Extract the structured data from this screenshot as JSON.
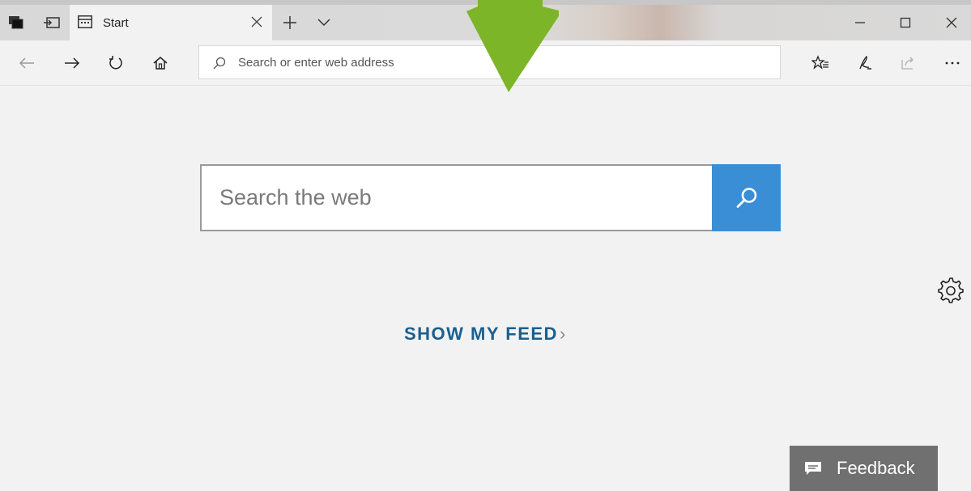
{
  "tabs": [
    {
      "title": "Start",
      "active": true
    }
  ],
  "titlebar": {
    "icons": [
      "set-aside-tabs-icon",
      "tab-preview-icon"
    ],
    "tab_menu_icon": "chevron-down-icon",
    "new_tab_icon": "plus-icon",
    "window_controls": [
      "minimize-icon",
      "maximize-icon",
      "close-icon"
    ]
  },
  "navbar": {
    "buttons": [
      "back-icon",
      "forward-icon",
      "refresh-icon",
      "home-icon"
    ],
    "address": {
      "placeholder": "Search or enter web address",
      "value": ""
    },
    "right_buttons": [
      "favorites-icon",
      "notes-icon",
      "share-icon",
      "more-icon"
    ]
  },
  "main": {
    "search": {
      "placeholder": "Search the web",
      "value": "",
      "button_icon": "search-icon"
    },
    "feed_link": {
      "label": "SHOW MY FEED",
      "chevron": "›"
    },
    "settings_icon": "gear-icon"
  },
  "feedback": {
    "label": "Feedback",
    "icon": "comment-icon"
  },
  "colors": {
    "accent": "#3a8ed6",
    "link": "#1b5f8f",
    "feedback_bg": "#707070",
    "arrow": "#7db529",
    "page_bg": "#f2f2f2"
  }
}
